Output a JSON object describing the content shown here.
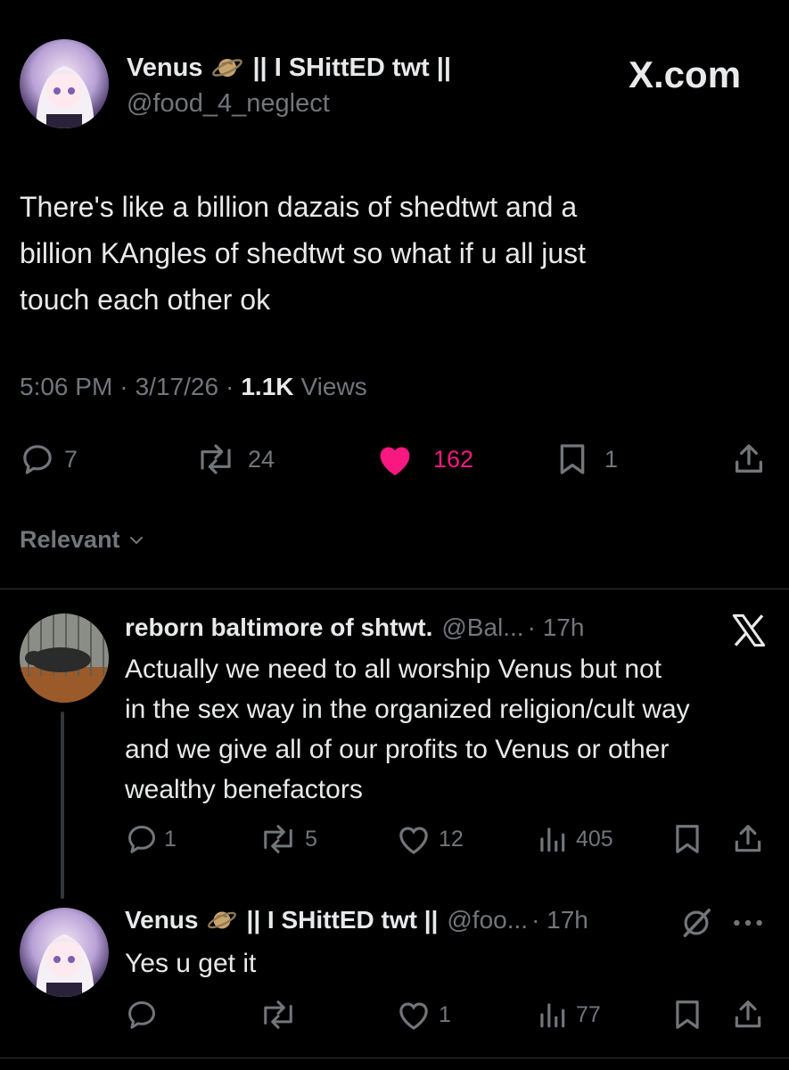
{
  "main_post": {
    "display_name": "Venus",
    "name_suffix": "|| I SHittED twt ||",
    "handle": "@food_4_neglect",
    "watermark": "X.com",
    "text_lines": [
      "There's like a billion dazais of shedtwt and a",
      "billion KAngles of shedtwt so what if u all just",
      "touch each other ok"
    ],
    "time": "5:06 PM",
    "date": "3/17/26",
    "views_count": "1.1K",
    "views_label": "Views",
    "sep": "·",
    "stats": {
      "replies": "7",
      "reposts": "24",
      "likes": "162",
      "bookmarks": "1"
    }
  },
  "sort": {
    "label": "Relevant"
  },
  "reply1": {
    "display_name": "reborn baltimore of shtwt.",
    "handle": "@Bal...",
    "time": "· 17h",
    "text_lines": [
      "Actually we need to all worship Venus but not",
      "in the sex way in the organized religion/cult way",
      "and we give all of our profits to Venus or other",
      "wealthy benefactors"
    ],
    "stats": {
      "replies": "1",
      "reposts": "5",
      "likes": "12",
      "views": "405"
    }
  },
  "reply2": {
    "display_name": "Venus",
    "name_suffix": "|| I SHittED twt ||",
    "handle": "@foo...",
    "time": "· 17h",
    "text_lines": [
      "Yes u get it"
    ],
    "stats": {
      "likes": "1",
      "views": "77"
    }
  },
  "colors": {
    "background": "#000000",
    "text": "#e7e9ea",
    "muted": "#71767b",
    "like": "#f91880",
    "divider": "#2f3336"
  }
}
